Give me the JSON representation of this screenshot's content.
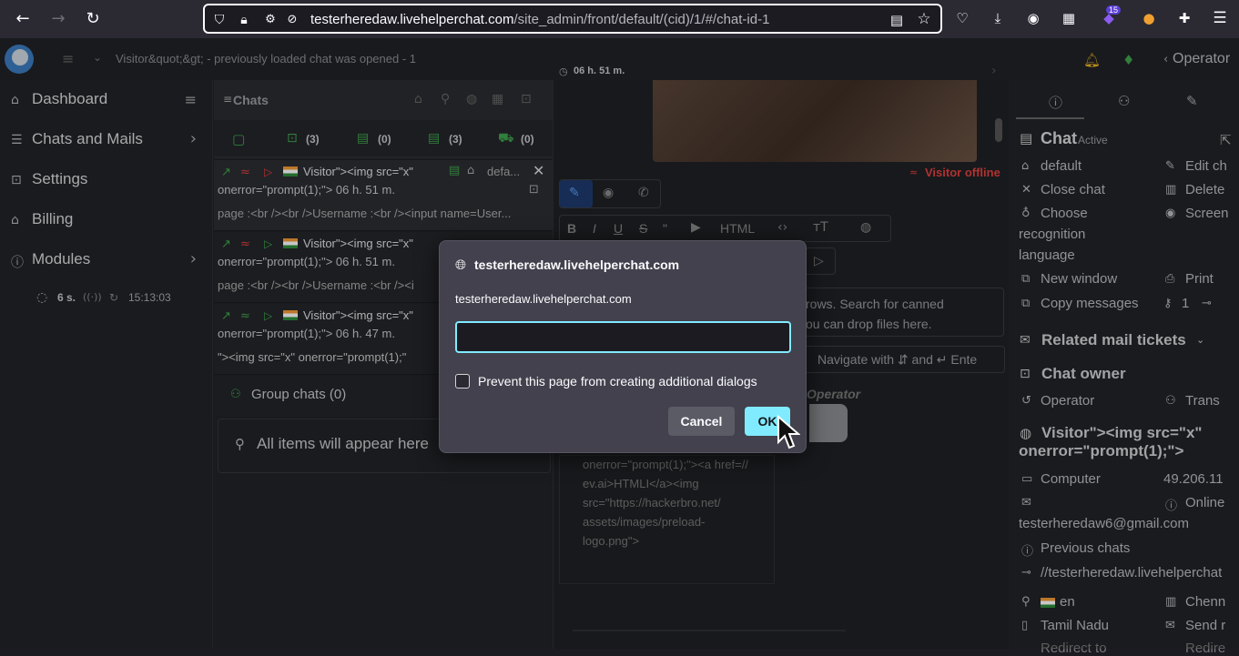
{
  "browser": {
    "url_host": "testerheredaw.livehelperchat.com",
    "url_path": "/site_admin/front/default/(cid)/1/#/chat-id-1",
    "ext_badge": "15"
  },
  "header": {
    "breadcrumb": "Visitor&quot;&gt; - previously loaded chat was opened - 1",
    "timer": "06 h. 51 m.",
    "operator_label": "Operator"
  },
  "sidebar": {
    "items": [
      {
        "label": "Dashboard"
      },
      {
        "label": "Chats and Mails"
      },
      {
        "label": "Settings"
      },
      {
        "label": "Billing"
      },
      {
        "label": "Modules"
      }
    ],
    "status": {
      "seconds": "6 s.",
      "time": "15:13:03"
    }
  },
  "chats": {
    "title": "Chats",
    "tab_counts": [
      "(3)",
      "(0)",
      "(3)",
      "(0)"
    ],
    "rows": [
      {
        "name": "Visitor\"><img src=\"x\"",
        "line2": "onerror=\"prompt(1);\"> 06 h. 51 m.",
        "dept": "defa...",
        "preview": "page :<br /><br />Username :<br /><input name=User..."
      },
      {
        "name": "Visitor\"><img src=\"x\"",
        "line2": "onerror=\"prompt(1);\"> 06 h. 51 m.",
        "preview": "page :<br /><br />Username :<br /><i"
      },
      {
        "name": "Visitor\"><img src=\"x\"",
        "line2": "onerror=\"prompt(1);\"> 06 h. 47 m.",
        "preview": "\"><img src=\"x\" onerror=\"prompt(1);\""
      }
    ],
    "group_chats": "Group chats (0)",
    "search_placeholder": "All items will appear here"
  },
  "middle": {
    "visitor_status": "Visitor offline",
    "editor_html": "HTML",
    "hint_line1": "rows. Search for canned",
    "hint_line2": "ou can drop files here.",
    "navigate": "Navigate with ⇵ and ↵ Ente",
    "operator_tag": "Operator",
    "message_lines": [
      "onerror=\"prompt(1);\"><a href=//",
      "ev.ai>HTMLI</a><img",
      "src=\"https://hackerbro.net/",
      "assets/images/preload-",
      "logo.png\">"
    ]
  },
  "right": {
    "chat_label": "Chat",
    "chat_status": "Active",
    "items_left": [
      "default",
      "Close chat",
      "Choose",
      "recognition",
      "language",
      "New window",
      "Copy messages"
    ],
    "items_right": [
      "Edit ch",
      "Delete",
      "Screen",
      "Print",
      "1"
    ],
    "related_mail": "Related mail tickets",
    "chat_owner": "Chat owner",
    "owner_name": "Operator",
    "owner_right": "Trans",
    "visitor_name_1": "Visitor\"><img src=\"x\"",
    "visitor_name_2": "onerror=\"prompt(1);\">",
    "device": "Computer",
    "ip": "49.206.11",
    "online": "Online",
    "email": "testerheredaw6@gmail.com",
    "previous_chats": "Previous chats",
    "ref_url": "//testerheredaw.livehelperchat",
    "lang": "en",
    "city": "Chenn",
    "region": "Tamil Nadu",
    "send": "Send r",
    "redirect": "Redirect to",
    "redir2": "Redire"
  },
  "dialog": {
    "title": "testerheredaw.livehelperchat.com",
    "message": "testerheredaw.livehelperchat.com",
    "input_value": "",
    "checkbox_label": "Prevent this page from creating additional dialogs",
    "cancel": "Cancel",
    "ok": "OK"
  },
  "colors": {
    "accent": "#80ebff",
    "dialog_bg": "#42414d",
    "app_bg": "#202226",
    "offline": "#e04040"
  }
}
